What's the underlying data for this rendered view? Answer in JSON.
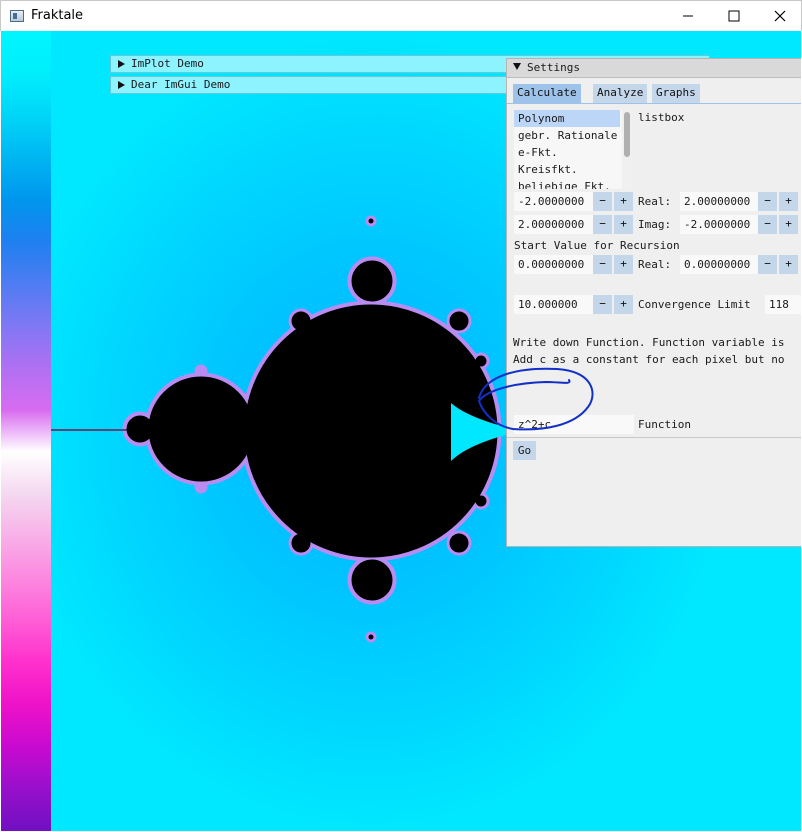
{
  "window": {
    "title": "Fraktale"
  },
  "colors": {
    "colorbar": [
      "#00f6ff",
      "#00eefc",
      "#00d6f8",
      "#00b6f2",
      "#0096ee",
      "#1f80f0",
      "#4f7cf2",
      "#7f78f4",
      "#b070f2",
      "#d86cf0",
      "#ffffff",
      "#f4d8f0",
      "#f8b0e8",
      "#fc88e0",
      "#fe5ed6",
      "#ff30cc",
      "#ee12c8",
      "#c80ad0",
      "#9810cc",
      "#7010c0"
    ],
    "mandel_body": "#000000",
    "mandel_edge": "#b98cf2",
    "fractal_bg": "#00e8ff"
  },
  "demo_windows": [
    {
      "label": "ImPlot Demo"
    },
    {
      "label": "Dear ImGui Demo"
    }
  ],
  "settings": {
    "title": "Settings",
    "tabs": [
      {
        "label": "Calculate",
        "active": true
      },
      {
        "label": "Analyze",
        "active": false
      },
      {
        "label": "Graphs",
        "active": false
      }
    ],
    "listbox_label": "listbox",
    "list_items": [
      "Polynom",
      "gebr. Rationale",
      "e-Fkt.",
      "Kreisfkt.",
      "beliebige Fkt."
    ],
    "selected_item": "Polynom",
    "row1": {
      "value": "-2.0000000",
      "label": "Real:",
      "value2": "2.00000000"
    },
    "row2": {
      "value": "2.00000000",
      "label": "Imag:",
      "value2": "-2.0000000"
    },
    "start_label": "Start Value for Recursion",
    "row3": {
      "value": "0.00000000",
      "label": "Real:",
      "value2": "0.00000000"
    },
    "row4": {
      "value": "10.000000",
      "label": "Convergence Limit",
      "value2": "118"
    },
    "desc1": "Write down Function. Function variable is",
    "desc2": "Add c as a constant for each pixel but no",
    "function_value": "z^2+c",
    "function_label": "Function",
    "go_label": "Go",
    "minus": "−",
    "plus": "+"
  }
}
